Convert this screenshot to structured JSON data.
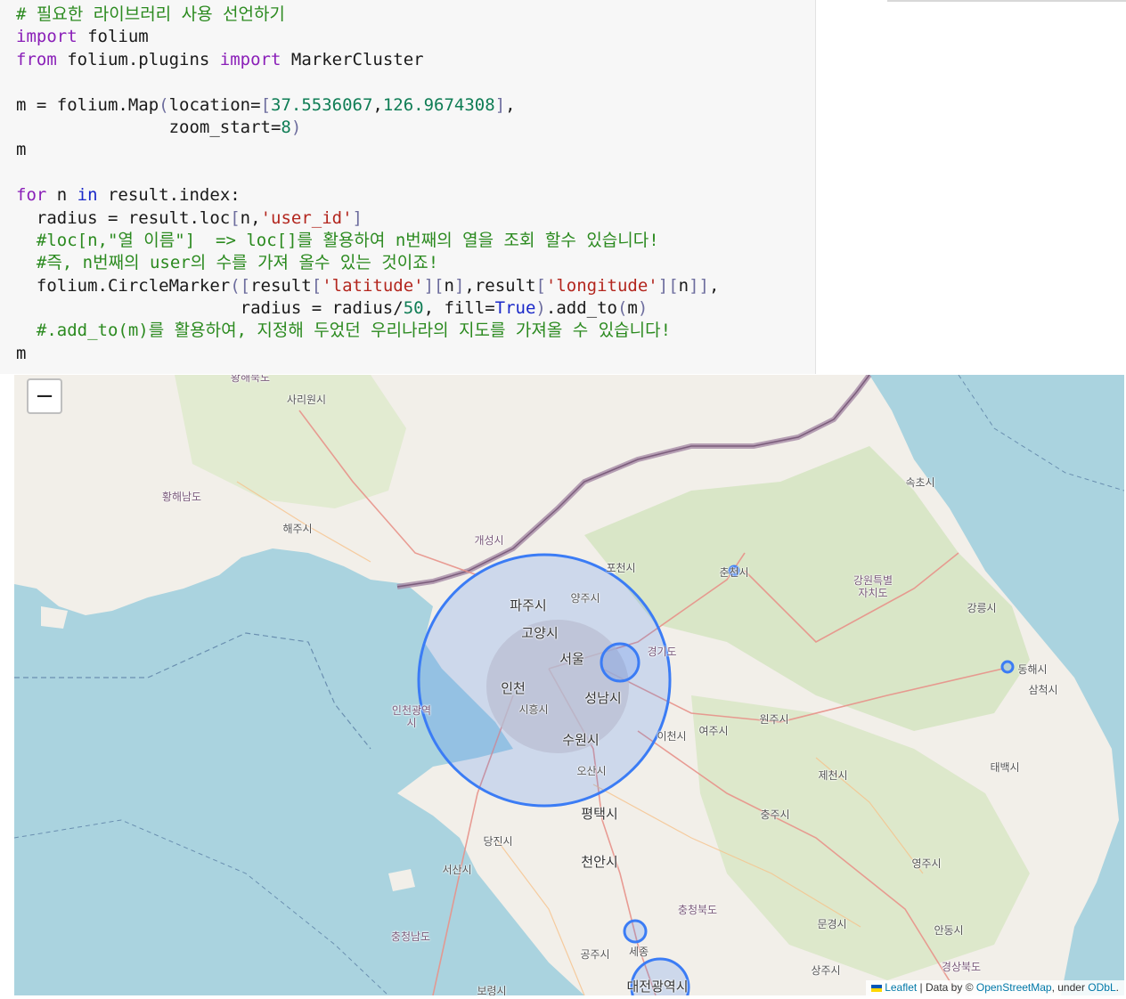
{
  "code_cell": {
    "lines": [
      [
        {
          "c": "cm",
          "t": "# 필요한 라이브러리 사용 선언하기"
        }
      ],
      [
        {
          "c": "kw",
          "t": "import"
        },
        {
          "c": "",
          "t": " folium"
        }
      ],
      [
        {
          "c": "kw",
          "t": "from"
        },
        {
          "c": "",
          "t": " folium.plugins "
        },
        {
          "c": "kw",
          "t": "import"
        },
        {
          "c": "",
          "t": " MarkerCluster"
        }
      ],
      [
        {
          "c": "",
          "t": ""
        }
      ],
      [
        {
          "c": "",
          "t": "m = folium.Map"
        },
        {
          "c": "br",
          "t": "("
        },
        {
          "c": "",
          "t": "location="
        },
        {
          "c": "br",
          "t": "["
        },
        {
          "c": "num",
          "t": "37.5536067"
        },
        {
          "c": "",
          "t": ","
        },
        {
          "c": "num",
          "t": "126.9674308"
        },
        {
          "c": "br",
          "t": "]"
        },
        {
          "c": "",
          "t": ","
        }
      ],
      [
        {
          "c": "",
          "t": "               zoom_start="
        },
        {
          "c": "num",
          "t": "8"
        },
        {
          "c": "br",
          "t": ")"
        }
      ],
      [
        {
          "c": "",
          "t": "m"
        }
      ],
      [
        {
          "c": "",
          "t": ""
        }
      ],
      [
        {
          "c": "kw",
          "t": "for"
        },
        {
          "c": "",
          "t": " n "
        },
        {
          "c": "kw2",
          "t": "in"
        },
        {
          "c": "",
          "t": " result.index:"
        }
      ],
      [
        {
          "c": "",
          "t": "  radius = result.loc"
        },
        {
          "c": "br",
          "t": "["
        },
        {
          "c": "",
          "t": "n,"
        },
        {
          "c": "str",
          "t": "'user_id'"
        },
        {
          "c": "br",
          "t": "]"
        }
      ],
      [
        {
          "c": "cm",
          "t": "  #loc[n,\"열 이름\"]  => loc[]를 활용하여 n번째의 열을 조회 할수 있습니다!"
        }
      ],
      [
        {
          "c": "cm",
          "t": "  #즉, n번째의 user의 수를 가져 올수 있는 것이죠!"
        }
      ],
      [
        {
          "c": "",
          "t": "  folium.CircleMarker"
        },
        {
          "c": "br",
          "t": "(["
        },
        {
          "c": "",
          "t": "result"
        },
        {
          "c": "br",
          "t": "["
        },
        {
          "c": "str",
          "t": "'latitude'"
        },
        {
          "c": "br",
          "t": "]["
        },
        {
          "c": "",
          "t": "n"
        },
        {
          "c": "br",
          "t": "]"
        },
        {
          "c": "",
          "t": ",result"
        },
        {
          "c": "br",
          "t": "["
        },
        {
          "c": "str",
          "t": "'longitude'"
        },
        {
          "c": "br",
          "t": "]["
        },
        {
          "c": "",
          "t": "n"
        },
        {
          "c": "br",
          "t": "]]"
        },
        {
          "c": "",
          "t": ","
        }
      ],
      [
        {
          "c": "",
          "t": "                      radius = radius/"
        },
        {
          "c": "num",
          "t": "50"
        },
        {
          "c": "",
          "t": ", fill="
        },
        {
          "c": "kw2",
          "t": "True"
        },
        {
          "c": "br",
          "t": ")"
        },
        {
          "c": "",
          "t": ".add_to"
        },
        {
          "c": "br",
          "t": "("
        },
        {
          "c": "",
          "t": "m"
        },
        {
          "c": "br",
          "t": ")"
        }
      ],
      [
        {
          "c": "cm",
          "t": "  #.add_to(m)를 활용하여, 지정해 두었던 우리나라의 지도를 가져올 수 있습니다!"
        }
      ],
      [
        {
          "c": "",
          "t": "m"
        }
      ]
    ]
  },
  "map": {
    "zoom_out_label": "−",
    "labels": {
      "hwanghae_top": "황해북도",
      "sariwon": "사리원시",
      "hwanghae_south": "황해남도",
      "haeju": "해주시",
      "kaesong": "개성시",
      "pocheon": "포천시",
      "chuncheon": "춘천시",
      "sokcho": "속초시",
      "gangwon": "강원특별\n자치도",
      "gangneung": "강릉시",
      "paju": "파주시",
      "yangju": "양주시",
      "goyang": "고양시",
      "seoul": "서울",
      "gyeonggi": "경기도",
      "incheon": "인천",
      "incheon_metro": "인천광역\n시",
      "siheung": "시흥시",
      "seongnam": "성남시",
      "suwon": "수원시",
      "icheon": "이천시",
      "yeoju": "여주시",
      "wonju": "원주시",
      "donghae": "동해시",
      "samcheok": "삼척시",
      "osan": "오산시",
      "taebaek": "태백시",
      "jecheon": "제천시",
      "pyeongtaek": "평택시",
      "chungju": "충주시",
      "dangjin": "당진시",
      "seosan": "서산시",
      "cheonan": "천안시",
      "yeongju": "영주시",
      "chungbuk": "충청북도",
      "chungnam": "충청남도",
      "mungyeong": "문경시",
      "andong": "안동시",
      "gongju": "공주시",
      "sejong": "세종",
      "sangju": "상주시",
      "gyeongbuk": "경상북도",
      "daejeon": "대전광역시",
      "boryeong": "보령시"
    },
    "marker_color": "#3b7cf5",
    "land_color": "#f2efe9",
    "sea_color": "#aad3df",
    "attribution": {
      "leaflet": "Leaflet",
      "data_by": " | Data by © ",
      "osm": "OpenStreetMap",
      "under": ", under ",
      "odbl": "ODbL",
      "period": "."
    }
  }
}
